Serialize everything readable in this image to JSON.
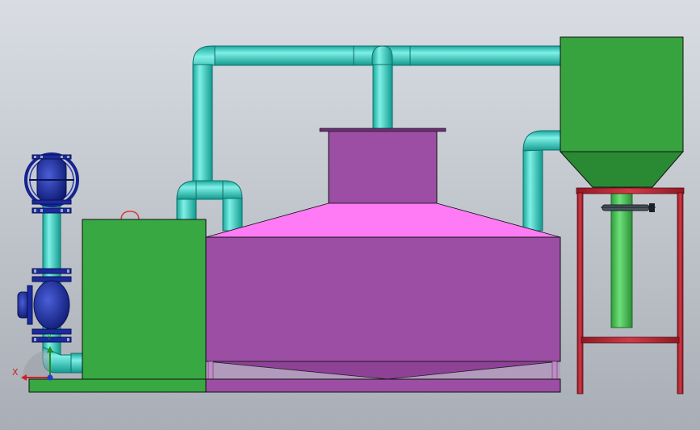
{
  "view": {
    "triad": {
      "x_label": "X",
      "y_label": "Y"
    }
  },
  "colors": {
    "pipe": "#29c9bd",
    "pipe_dark": "#16948a",
    "machine_green": "#36a33f",
    "tank_purple": "#9b4ea3",
    "tank_pink": "#ff7af5",
    "valve_blue": "#16238f",
    "frame_red": "#b72533",
    "background": "#c3c8cf"
  }
}
